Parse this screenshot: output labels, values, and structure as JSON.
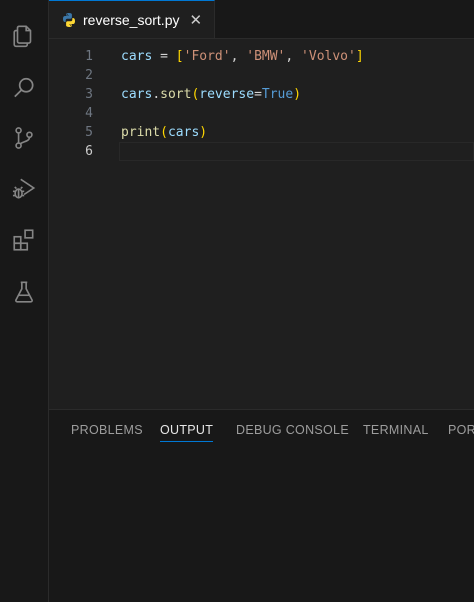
{
  "tab": {
    "filename": "reverse_sort.py",
    "close_glyph": "✕"
  },
  "editor": {
    "lines": [
      {
        "num": "1",
        "tokens": [
          {
            "t": "cars",
            "c": "v"
          },
          {
            "t": " = ",
            "c": "p"
          },
          {
            "t": "[",
            "c": "b"
          },
          {
            "t": "'Ford'",
            "c": "s"
          },
          {
            "t": ", ",
            "c": "p"
          },
          {
            "t": "'BMW'",
            "c": "s"
          },
          {
            "t": ", ",
            "c": "p"
          },
          {
            "t": "'Volvo'",
            "c": "s"
          },
          {
            "t": "]",
            "c": "b"
          }
        ]
      },
      {
        "num": "2",
        "tokens": []
      },
      {
        "num": "3",
        "tokens": [
          {
            "t": "cars",
            "c": "v"
          },
          {
            "t": ".",
            "c": "p"
          },
          {
            "t": "sort",
            "c": "f"
          },
          {
            "t": "(",
            "c": "b"
          },
          {
            "t": "reverse",
            "c": "v"
          },
          {
            "t": "=",
            "c": "p"
          },
          {
            "t": "True",
            "c": "k"
          },
          {
            "t": ")",
            "c": "b"
          }
        ]
      },
      {
        "num": "4",
        "tokens": []
      },
      {
        "num": "5",
        "tokens": [
          {
            "t": "print",
            "c": "f"
          },
          {
            "t": "(",
            "c": "b"
          },
          {
            "t": "cars",
            "c": "v"
          },
          {
            "t": ")",
            "c": "b"
          }
        ]
      },
      {
        "num": "6",
        "tokens": [],
        "active": true
      }
    ]
  },
  "panel": {
    "tabs": [
      "PROBLEMS",
      "OUTPUT",
      "DEBUG CONSOLE",
      "TERMINAL",
      "PORTS"
    ],
    "active": "OUTPUT"
  },
  "activity_icons": [
    "files-icon",
    "search-icon",
    "source-control-icon",
    "run-debug-icon",
    "extensions-icon",
    "testing-icon"
  ],
  "colors": {
    "accent": "#0078d4",
    "editor_bg": "#1f1f1f",
    "sidebar_bg": "#181818"
  }
}
